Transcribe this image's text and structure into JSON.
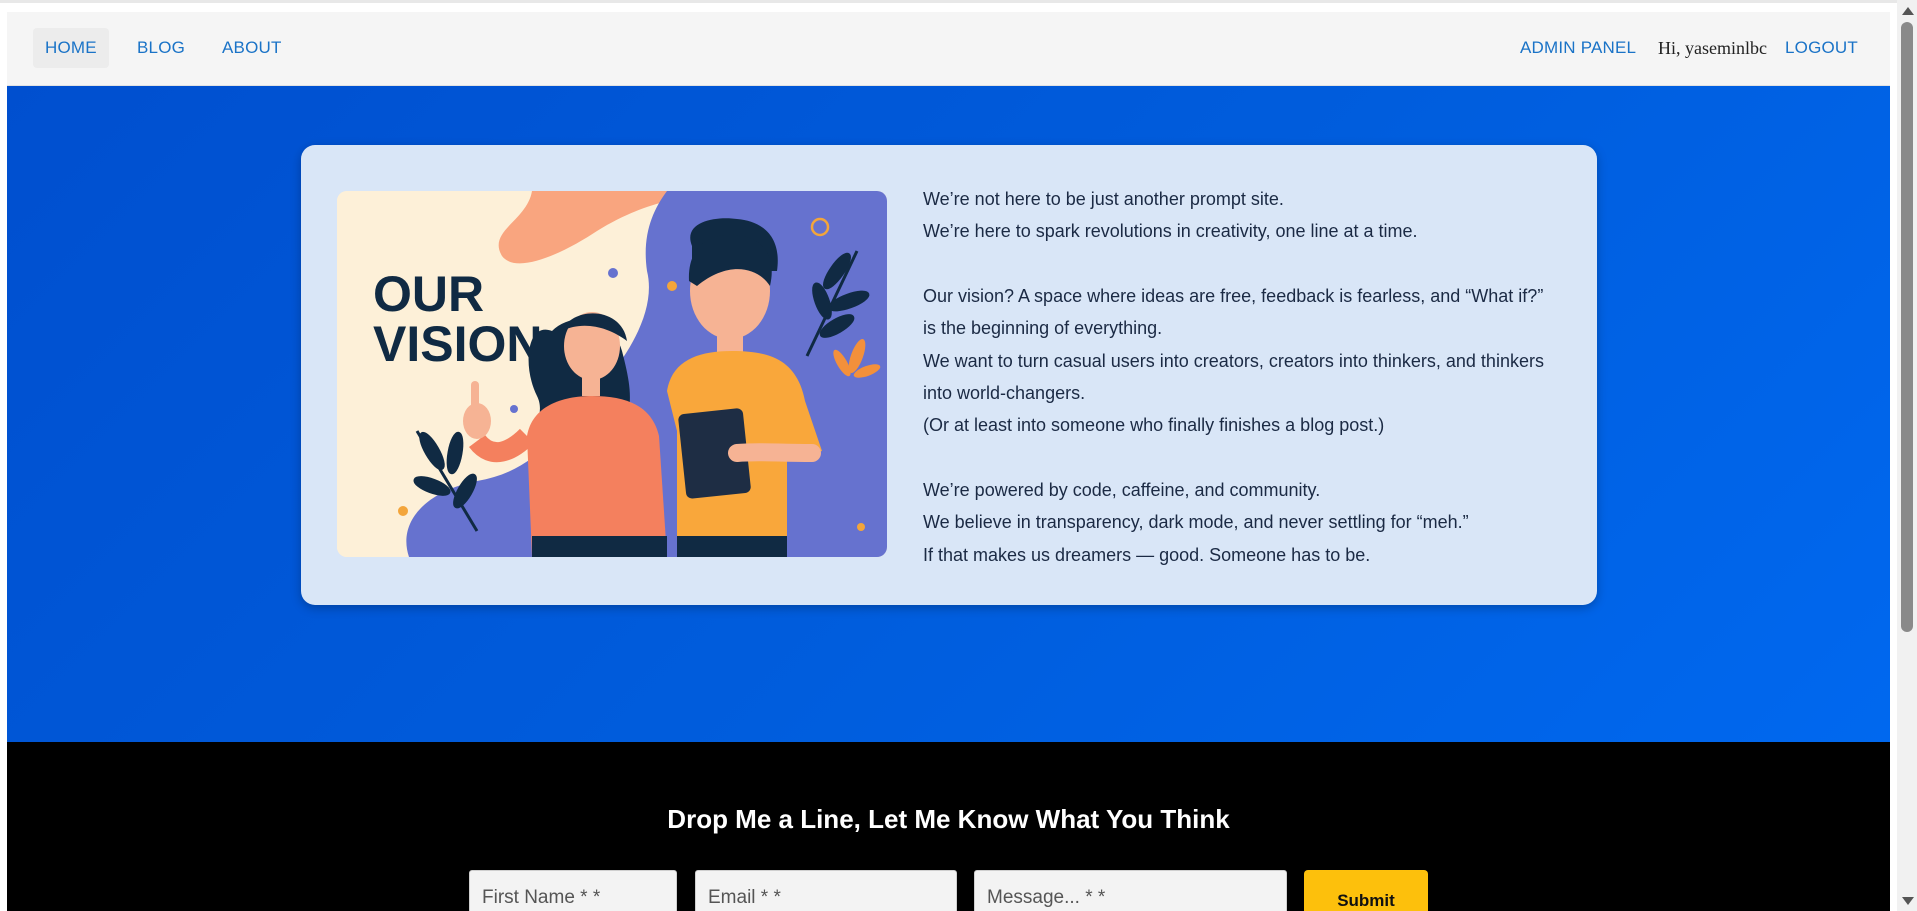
{
  "nav": {
    "home": "HOME",
    "blog": "BLOG",
    "about": "ABOUT",
    "admin_panel": "ADMIN PANEL",
    "greeting": "Hi, yaseminlbc",
    "logout": "LOGOUT"
  },
  "vision": {
    "image_heading_line1": "OUR",
    "image_heading_line2": "VISION",
    "paragraph1": [
      "We’re not here to be just another prompt site.",
      "We’re here to spark revolutions in creativity, one line at a time."
    ],
    "paragraph2": [
      "Our vision? A space where ideas are free, feedback is fearless, and “What if?”",
      "is the beginning of everything.",
      "We want to turn casual users into creators, creators into thinkers, and thinkers",
      "into world-changers.",
      "(Or at least into someone who finally finishes a blog post.)"
    ],
    "paragraph3": [
      "We’re powered by code, caffeine, and community.",
      "We believe in transparency, dark mode, and never settling for “meh.”",
      "If that makes us dreamers — good. Someone has to be."
    ]
  },
  "contact": {
    "title": "Drop Me a Line, Let Me Know What You Think",
    "first_name_placeholder": "First Name * *",
    "email_placeholder": "Email * *",
    "message_placeholder": "Message... * *",
    "submit_label": "Submit"
  },
  "colors": {
    "hero_blue": "#005ddd",
    "card_bg": "#d9e6f7",
    "nav_link": "#1a73c7",
    "submit_yellow": "#fdc00c",
    "footer_bg": "#000000"
  }
}
